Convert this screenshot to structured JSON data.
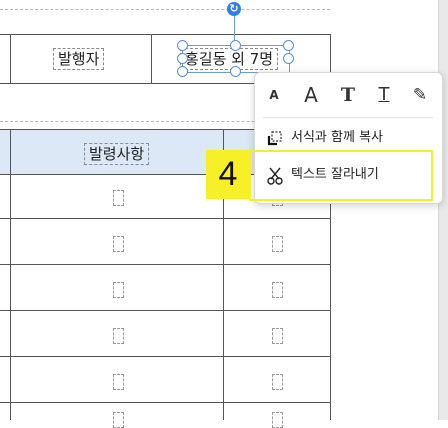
{
  "header_row": {
    "publisher_label": "발행자",
    "publisher_value": "홍길동 외 7명"
  },
  "table": {
    "column_header": "발령사항",
    "row_count": 6
  },
  "toolbar": {
    "buttons": [
      {
        "name": "small-font",
        "glyph": "A"
      },
      {
        "name": "large-font",
        "glyph": "A"
      },
      {
        "name": "bold",
        "glyph": "T"
      },
      {
        "name": "underline",
        "glyph": "T"
      },
      {
        "name": "highlight",
        "glyph": "✎"
      }
    ]
  },
  "menu": {
    "copy_with_format": "서식과 함께 복사",
    "cut_text": "텍스트 잘라내기"
  },
  "step": {
    "number": "4",
    "color": "#f7f028"
  },
  "rotate_handle_glyph": "↻"
}
